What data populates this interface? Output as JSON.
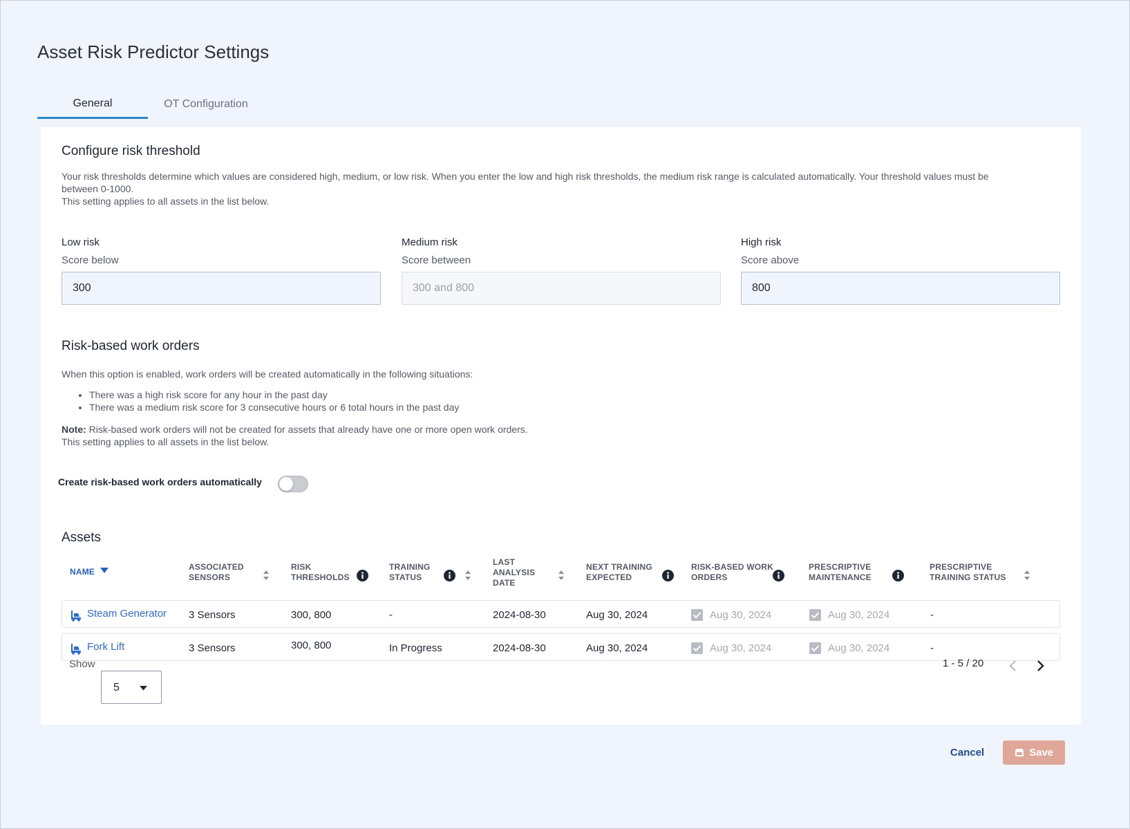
{
  "page": {
    "title": "Asset Risk Predictor Settings"
  },
  "tabs": [
    {
      "label": "General",
      "active": true
    },
    {
      "label": "OT Configuration",
      "active": false
    }
  ],
  "threshold": {
    "title": "Configure risk threshold",
    "desc_line1": "Your risk thresholds determine which values are considered high, medium, or low risk. When you enter the low and high risk thresholds, the medium risk range is calculated automatically. Your threshold values must be",
    "desc_line2": "between 0-1000.",
    "desc_line3": "This setting applies to all assets in the list below.",
    "low": {
      "label": "Low risk",
      "sub": "Score below",
      "value": "300"
    },
    "medium": {
      "label": "Medium risk",
      "sub": "Score between",
      "placeholder": "300 and 800"
    },
    "high": {
      "label": "High risk",
      "sub": "Score above",
      "value": "800"
    }
  },
  "work_orders": {
    "title": "Risk-based work orders",
    "intro": "When this option is enabled, work orders will be created automatically in the following situations:",
    "bullets": [
      "There was a high risk score for any hour in the past day",
      "There was a medium risk score for 3 consecutive hours or 6 total hours in the past day"
    ],
    "note_label": "Note:",
    "note_text": " Risk-based work orders will not be created for assets that already have one or more open work orders.",
    "note_line2": "This setting applies to all assets in the list below.",
    "toggle_label": "Create risk-based work orders automatically",
    "toggle_on": false
  },
  "assets": {
    "title": "Assets",
    "columns": {
      "name": "NAME",
      "sensors_1": "ASSOCIATED",
      "sensors_2": "SENSORS",
      "thresholds_1": "RISK",
      "thresholds_2": "THRESHOLDS",
      "training_1": "TRAINING",
      "training_2": "STATUS",
      "analysis_1": "LAST",
      "analysis_2": "ANALYSIS",
      "analysis_3": "DATE",
      "next_1": "NEXT TRAINING",
      "next_2": "EXPECTED",
      "rbwo_1": "RISK-BASED WORK",
      "rbwo_2": "ORDERS",
      "pm_1": "PRESCRIPTIVE",
      "pm_2": "MAINTENANCE",
      "pts_1": "PRESCRIPTIVE",
      "pts_2": "TRAINING STATUS"
    },
    "rows": [
      {
        "name": "Steam Generator",
        "sensors": "3 Sensors",
        "thresholds": "300, 800",
        "training": "-",
        "analysis": "2024-08-30",
        "next": "Aug 30, 2024",
        "rbwo": "Aug 30, 2024",
        "pm": "Aug 30, 2024",
        "pts": "-"
      },
      {
        "name": "Fork Lift",
        "sensors": "3 Sensors",
        "thresholds": "300, 800",
        "training": "In Progress",
        "analysis": "2024-08-30",
        "next": "Aug 30, 2024",
        "rbwo": "Aug 30, 2024",
        "pm": "Aug 30, 2024",
        "pts": "-"
      }
    ],
    "show_label": "Show",
    "page_size": "5",
    "range": "1 - 5 / 20"
  },
  "footer": {
    "cancel": "Cancel",
    "save": "Save"
  },
  "colors": {
    "accent": "#2f86c8",
    "link": "#2f6cc9",
    "save_disabled": "#dea797",
    "background": "#f0f5fd"
  }
}
